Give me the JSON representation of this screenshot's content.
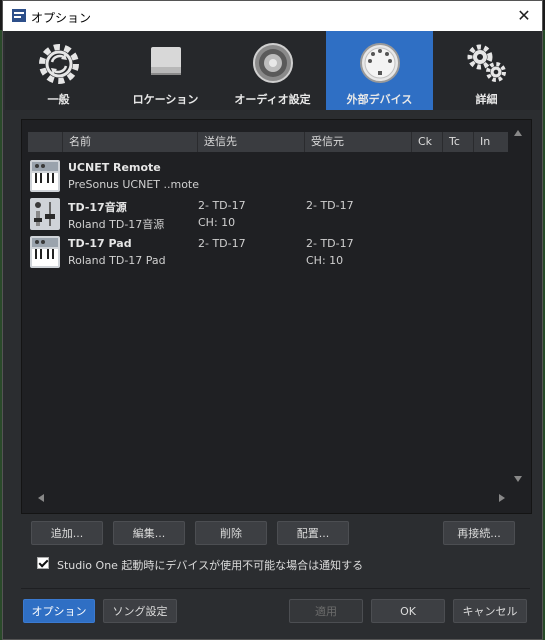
{
  "window": {
    "title": "オプション",
    "close_glyph": "✕"
  },
  "tabs": [
    {
      "label": "一般",
      "icon": "sync-gear-icon",
      "active": false
    },
    {
      "label": "ロケーション",
      "icon": "drive-icon",
      "active": false
    },
    {
      "label": "オーディオ設定",
      "icon": "speaker-icon",
      "active": false
    },
    {
      "label": "外部デバイス",
      "icon": "midi-port-icon",
      "active": true
    },
    {
      "label": "詳細",
      "icon": "gears-icon",
      "active": false
    }
  ],
  "table": {
    "columns": [
      "名前",
      "送信先",
      "受信元",
      "Ck",
      "Tc",
      "In"
    ],
    "rows": [
      {
        "name": "UCNET Remote",
        "sub": "PreSonus UCNET ..mote",
        "send": "",
        "send_sub": "",
        "recv": "",
        "recv_sub": "",
        "icon": "keyboard-icon"
      },
      {
        "name": "TD-17音源",
        "sub": "Roland TD-17音源",
        "send": "2- TD-17",
        "send_sub": "CH: 10",
        "recv": "2- TD-17",
        "recv_sub": "",
        "icon": "mixer-fader-icon"
      },
      {
        "name": "TD-17 Pad",
        "sub": "Roland TD-17 Pad",
        "send": "2- TD-17",
        "send_sub": "",
        "recv": "2- TD-17",
        "recv_sub": "CH: 10",
        "icon": "keyboard-icon"
      }
    ]
  },
  "buttons": {
    "add": "追加...",
    "edit": "編集...",
    "delete": "削除",
    "arrange": "配置...",
    "reconnect": "再接続...",
    "options": "オプション",
    "song_settings": "ソング設定",
    "apply": "適用",
    "ok": "OK",
    "cancel": "キャンセル"
  },
  "notify_checkbox": {
    "label": "Studio One 起動時にデバイスが使用不可能な場合は通知する",
    "checked": true
  },
  "colors": {
    "accent": "#2f6fc4",
    "window_bg": "#2b2d30",
    "panel_bg": "#1f2023"
  }
}
